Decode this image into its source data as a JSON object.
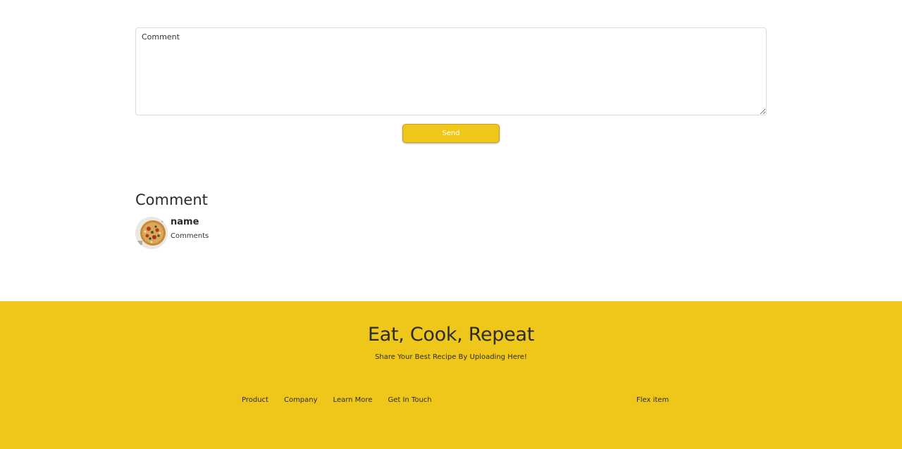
{
  "comment_form": {
    "placeholder": "Comment",
    "send_label": "Send"
  },
  "comments": {
    "heading": "Comment",
    "items": [
      {
        "name": "name",
        "text": "Comments"
      }
    ]
  },
  "footer": {
    "title": "Eat, Cook, Repeat",
    "subtitle": "Share Your Best Recipe By Uploading Here!",
    "links": [
      "Product",
      "Company",
      "Learn More",
      "Get In Touch"
    ],
    "flex_item": "Flex item"
  },
  "colors": {
    "accent": "#efc71a",
    "text": "#2b2b2b",
    "background": "#ffffff"
  }
}
